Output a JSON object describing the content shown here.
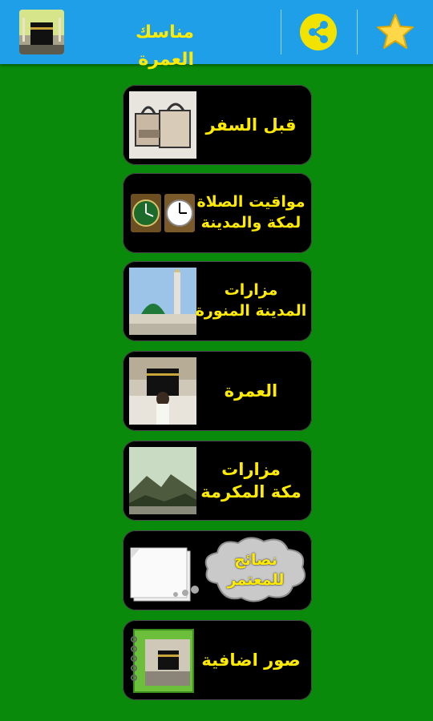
{
  "appbar": {
    "title": "مناسك العمرة",
    "app_icon": "kaaba-app-icon",
    "share_icon": "share-icon",
    "star_icon": "star-icon",
    "background": "#1e9fe8",
    "title_color": "#ffeb00"
  },
  "page": {
    "background": "#0a8a0a"
  },
  "menu": {
    "items": [
      {
        "label": "قبل السفر",
        "icon": "luggage-icon"
      },
      {
        "label": "مواقيت الصلاة\nلمكة والمدينة",
        "icon": "clocks-icon"
      },
      {
        "label": "مزارات\nالمدينة المنورة",
        "icon": "prophets-mosque-icon"
      },
      {
        "label": "العمرة",
        "icon": "kaaba-pilgrim-icon"
      },
      {
        "label": "مزارات\nمكة المكرمة",
        "icon": "mountain-landscape-icon"
      },
      {
        "label": "نصائح\nللمعتمر",
        "icon": "papers-thought-cloud-icon"
      },
      {
        "label": "صور اضافية",
        "icon": "photo-album-icon"
      }
    ]
  }
}
